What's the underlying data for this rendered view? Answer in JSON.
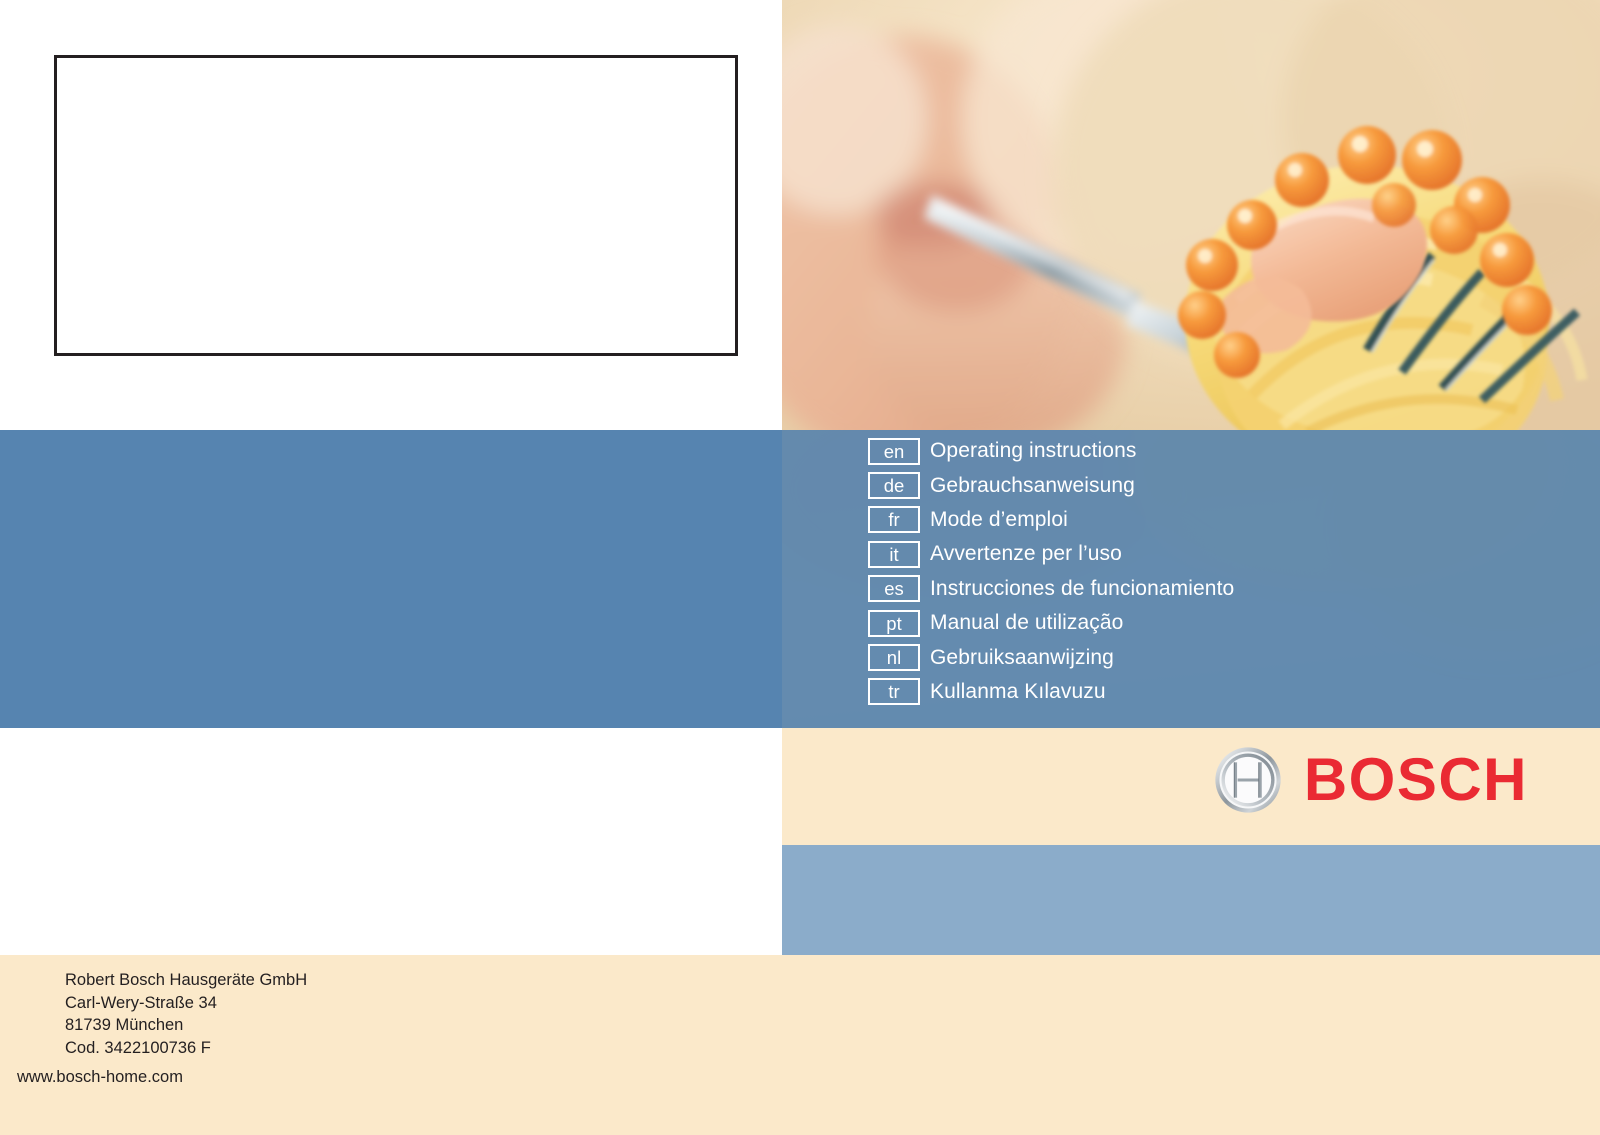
{
  "document": {
    "type": "appliance-manual-cover",
    "brand": "BOSCH"
  },
  "placeholder_box": {
    "content": ""
  },
  "photo": {
    "alt": "Close-up of a person eating spaghetti with salmon and roe on a fork",
    "colors": {
      "pasta": "#f6d97a",
      "roe": "#f09440",
      "salmon": "#f3b894",
      "background": "#f0dcc0",
      "fork": "#cdd6db"
    }
  },
  "languages": [
    {
      "code": "en",
      "label": "Operating  instructions"
    },
    {
      "code": "de",
      "label": "Gebrauchsanweisung"
    },
    {
      "code": "fr",
      "label": "Mode d’emploi"
    },
    {
      "code": "it",
      "label": "Avvertenze per l’uso"
    },
    {
      "code": "es",
      "label": "Instrucciones de funcionamiento"
    },
    {
      "code": "pt",
      "label": "Manual de utilização"
    },
    {
      "code": "nl",
      "label": "Gebruiksaanwijzing"
    },
    {
      "code": "tr",
      "label": "Kullanma Kılavuzu"
    }
  ],
  "logo": {
    "wordmark": "BOSCH",
    "color": "#ea2a33"
  },
  "footer": {
    "address": [
      "Robert Bosch Hausgeräte GmbH",
      "Carl-Wery-Straße 34",
      "81739 München",
      "Cod. 3422100736 F"
    ],
    "website": "www.bosch-home.com"
  },
  "colors": {
    "blue_band": "#5684b0",
    "light_blue_band": "#8bacca",
    "cream": "#fbe9ca",
    "accent_red": "#ea2a33",
    "text": "#231f20"
  }
}
